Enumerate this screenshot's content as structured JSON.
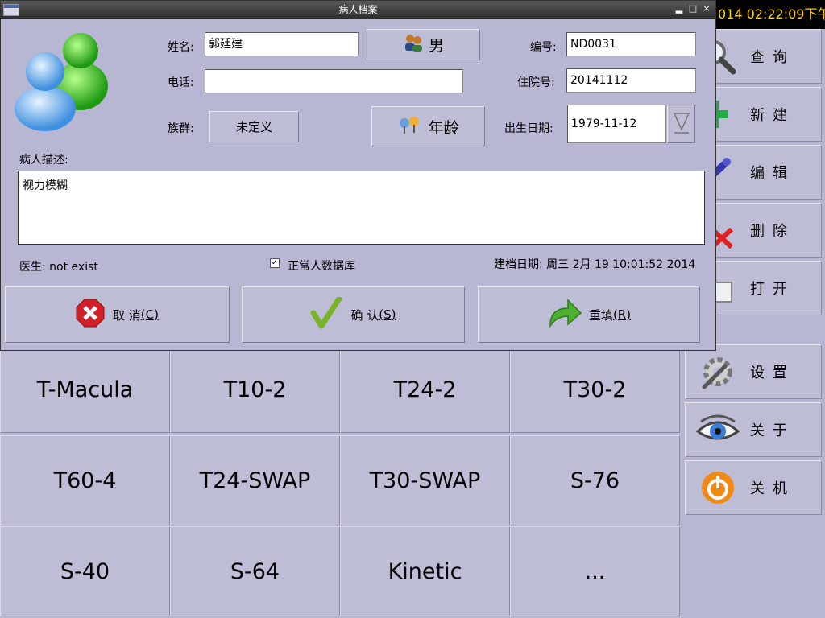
{
  "clock": "014 02:22:09下午",
  "sidebar": {
    "items": [
      {
        "label": "查询",
        "icon": "magnifier-icon"
      },
      {
        "label": "新建",
        "icon": "plus-icon"
      },
      {
        "label": "编辑",
        "icon": "pen-icon"
      },
      {
        "label": "删除",
        "icon": "delete-x-icon"
      },
      {
        "label": "打开",
        "icon": "folder-icon"
      },
      {
        "label": "设置",
        "icon": "gear-wrench-icon"
      },
      {
        "label": "关于",
        "icon": "eye-icon"
      },
      {
        "label": "关机",
        "icon": "power-icon"
      }
    ]
  },
  "tests": [
    "T-Macula",
    "T10-2",
    "T24-2",
    "T30-2",
    "T60-4",
    "T24-SWAP",
    "T30-SWAP",
    "S-76",
    "S-40",
    "S-64",
    "Kinetic",
    "..."
  ],
  "dialog": {
    "title": "病人档案",
    "name_label": "姓名:",
    "name_value": "郭廷建",
    "gender_button": "男",
    "id_label": "编号:",
    "id_value": "ND0031",
    "phone_label": "电话:",
    "phone_value": "",
    "inpatient_label": "住院号:",
    "inpatient_value": "20141112",
    "ethnic_label": "族群:",
    "ethnic_value": "未定义",
    "age_button": "年龄",
    "birth_label": "出生日期:",
    "birth_value": "1979-11-12",
    "desc_label": "病人描述:",
    "desc_value": "视力模糊",
    "doctor": "医生: not exist",
    "normal_db_label": "正常人数据库",
    "normal_db_checked": true,
    "created": "建档日期: 周三 2月 19 10:01:52 2014",
    "cancel_label": "取 消",
    "cancel_key": "(C)",
    "confirm_label": "确 认",
    "confirm_key": "(S)",
    "reset_label": "重填",
    "reset_key": "(R)"
  }
}
